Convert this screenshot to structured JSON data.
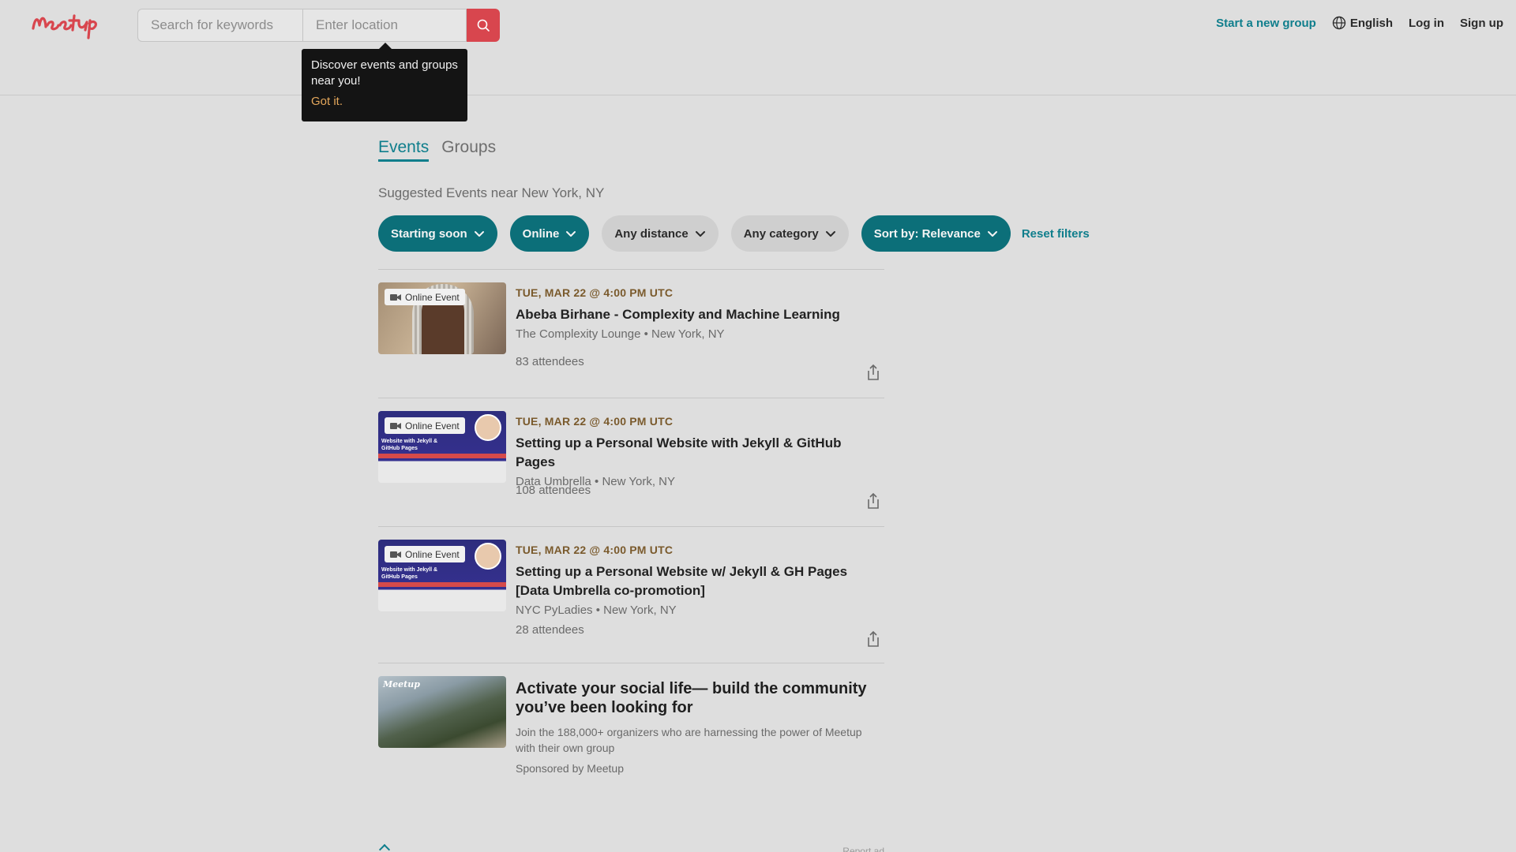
{
  "header": {
    "logo_text": "Meetup",
    "search_placeholder": "Search for keywords",
    "location_placeholder": "Enter location",
    "start_group": "Start a new group",
    "language": "English",
    "login": "Log in",
    "signup": "Sign up"
  },
  "tooltip": {
    "text": "Discover events and groups near you!",
    "action": "Got it."
  },
  "tabs": [
    {
      "label": "Events",
      "active": true
    },
    {
      "label": "Groups",
      "active": false
    }
  ],
  "suggested_heading": "Suggested Events near New York, NY",
  "filters": [
    {
      "label": "Starting soon",
      "active": true
    },
    {
      "label": "Online",
      "active": true
    },
    {
      "label": "Any distance",
      "active": false
    },
    {
      "label": "Any category",
      "active": false
    },
    {
      "label": "Sort by: Relevance",
      "active": true
    }
  ],
  "reset_filters": "Reset filters",
  "events": [
    {
      "badge": "Online Event",
      "date": "TUE, MAR 22 @ 4:00 PM UTC",
      "title": "Abeba Birhane - Complexity and Machine Learning",
      "group": "The Complexity Lounge • New York, NY",
      "attendees": "83 attendees"
    },
    {
      "badge": "Online Event",
      "date": "TUE, MAR 22 @ 4:00 PM UTC",
      "title": "Setting up a Personal Website with Jekyll & GitHub Pages",
      "group": "Data Umbrella • New York, NY",
      "attendees": "108 attendees",
      "thumb_text": "Website with Jekyll & GitHub Pages"
    },
    {
      "badge": "Online Event",
      "date": "TUE, MAR 22 @ 4:00 PM UTC",
      "title": "Setting up a Personal Website w/ Jekyll & GH Pages [Data Umbrella co-promotion]",
      "group": "NYC PyLadies • New York, NY",
      "attendees": "28 attendees",
      "thumb_text": "Website with Jekyll & GitHub Pages"
    }
  ],
  "ad": {
    "thumb_logo": "Meetup",
    "title": "Activate your social life— build the community you’ve been looking for",
    "body": "Join the 188,000+ organizers who are harnessing the power of Meetup with their own group",
    "sponsor": "Sponsored by Meetup"
  },
  "report_ad": "Report ad",
  "colors": {
    "brand": "#d8464e",
    "teal": "#0f7e8c",
    "chip_active": "#0c6f79",
    "date_text": "#7a5a2c"
  }
}
